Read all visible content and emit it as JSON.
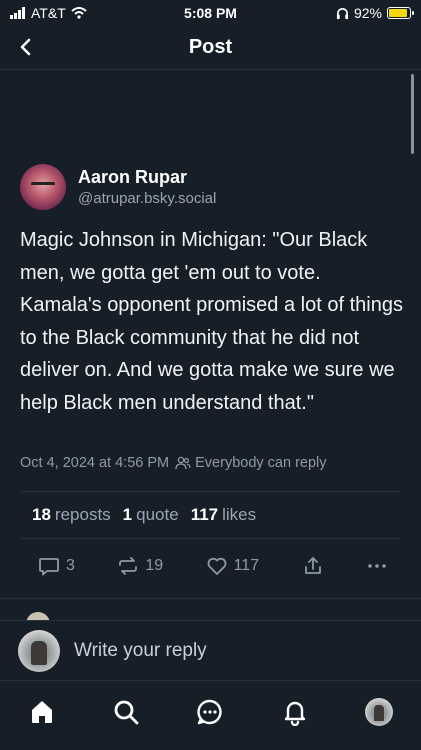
{
  "status_bar": {
    "carrier": "AT&T",
    "time": "5:08 PM",
    "battery_percent": "92%",
    "battery_level": 0.92
  },
  "header": {
    "title": "Post"
  },
  "post": {
    "author": {
      "name": "Aaron Rupar",
      "handle": "@atrupar.bsky.social"
    },
    "text": "Magic Johnson in Michigan: \"Our Black men, we gotta get 'em out to vote. Kamala's opponent promised a lot of things to the Black community that he did not deliver on. And we gotta make we sure we help Black men understand that.\"",
    "timestamp": "Oct 4, 2024 at 4:56 PM",
    "reply_permission": "Everybody can reply",
    "stats": {
      "reposts_count": "18",
      "reposts_label": "reposts",
      "quotes_count": "1",
      "quotes_label": "quote",
      "likes_count": "117",
      "likes_label": "likes"
    },
    "actions": {
      "reply_count": "3",
      "repost_count": "19",
      "like_count": "117"
    }
  },
  "composer": {
    "placeholder": "Write your reply"
  },
  "tab_bar": {
    "items": [
      "home-icon",
      "search-icon",
      "chat-icon",
      "notifications-icon",
      "profile-avatar"
    ]
  },
  "colors": {
    "background": "#161e27",
    "text_primary": "#f1f3f5",
    "text_secondary": "#8f9aa6",
    "divider": "#26303b",
    "battery": "#f5d90a"
  }
}
